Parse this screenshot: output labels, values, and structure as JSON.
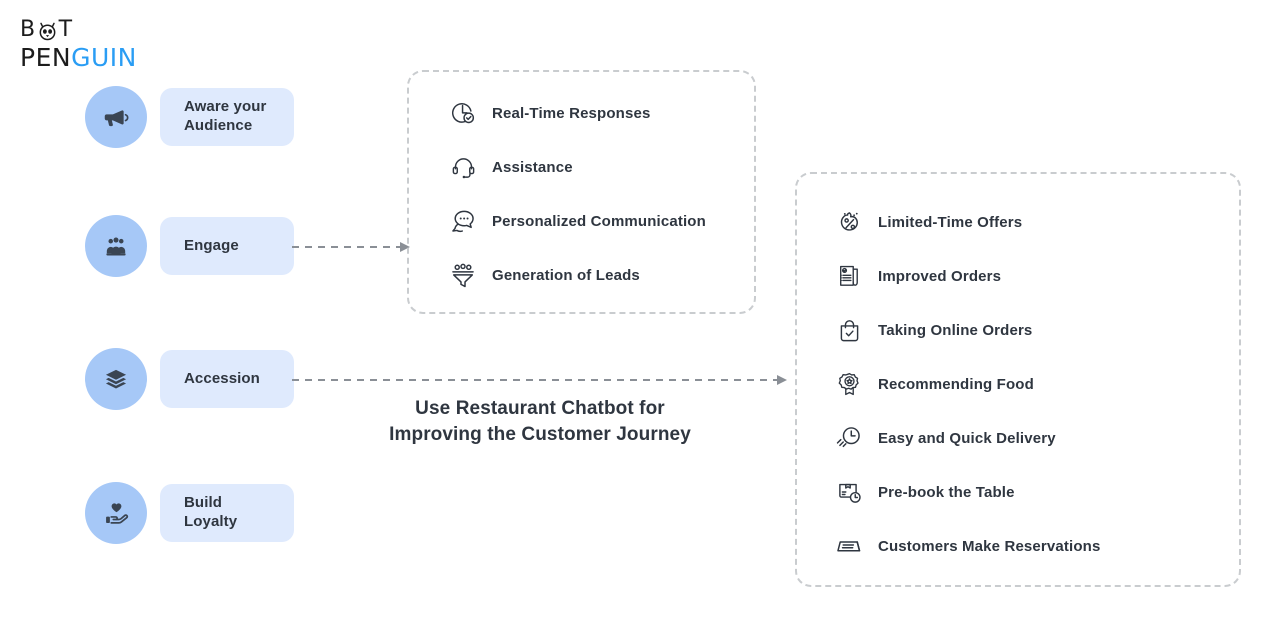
{
  "logo": {
    "part1": "B",
    "part2": "T",
    "part3": "PEN",
    "part4": "GUIN",
    "accent_color": "#2a9df4",
    "icon": "penguin-icon"
  },
  "stages": [
    {
      "label": "Aware your\nAudience",
      "icon": "megaphone-icon",
      "pill_width": 134
    },
    {
      "label": "Engage",
      "icon": "audience-group-icon",
      "pill_width": 134
    },
    {
      "label": "Accession",
      "icon": "layers-stack-icon",
      "pill_width": 134
    },
    {
      "label": "Build\nLoyalty",
      "icon": "heart-in-hand-icon",
      "pill_width": 134
    }
  ],
  "middle_panel": {
    "items": [
      {
        "label": "Real-Time Responses",
        "icon": "clock-check-icon"
      },
      {
        "label": "Assistance",
        "icon": "headset-icon"
      },
      {
        "label": "Personalized Communication",
        "icon": "chat-bubbles-icon"
      },
      {
        "label": "Generation of Leads",
        "icon": "funnel-leads-icon"
      }
    ]
  },
  "right_panel": {
    "items": [
      {
        "label": "Limited-Time Offers",
        "icon": "discount-percent-icon"
      },
      {
        "label": "Improved Orders",
        "icon": "order-document-icon"
      },
      {
        "label": "Taking Online Orders",
        "icon": "shopping-bag-check-icon"
      },
      {
        "label": "Recommending Food",
        "icon": "badge-star-icon"
      },
      {
        "label": "Easy and Quick Delivery",
        "icon": "fast-clock-icon"
      },
      {
        "label": "Pre-book the Table",
        "icon": "box-clock-icon"
      },
      {
        "label": "Customers Make Reservations",
        "icon": "reservation-card-icon"
      }
    ]
  },
  "headline": {
    "text": "Use Restaurant Chatbot for\nImproving the Customer Journey"
  },
  "colors": {
    "circle": "#a6c8f7",
    "pill": "#dfeafd",
    "text": "#2f3640",
    "dashed_border": "#c9cccf",
    "connector": "#8a8f96"
  }
}
